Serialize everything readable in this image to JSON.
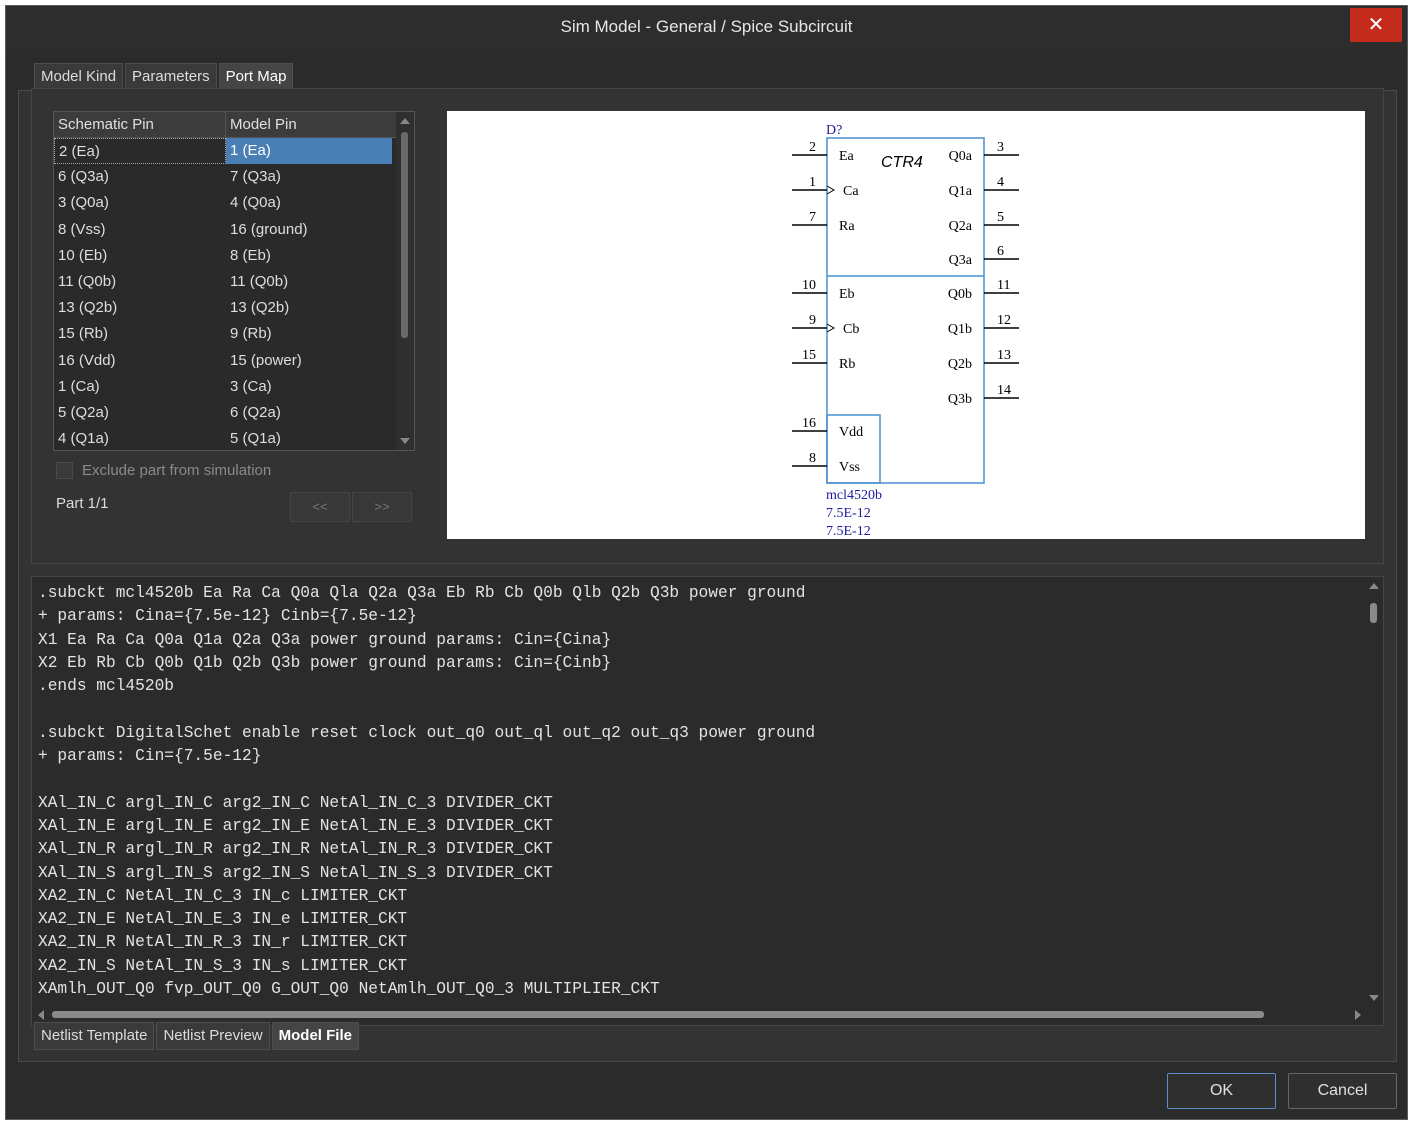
{
  "window": {
    "title": "Sim Model - General / Spice Subcircuit",
    "close_label": "✕"
  },
  "top_tabs": [
    {
      "label": "Model Kind",
      "active": false
    },
    {
      "label": "Parameters",
      "active": false
    },
    {
      "label": "Port Map",
      "active": true
    }
  ],
  "port_map": {
    "headers": {
      "schematic": "Schematic Pin",
      "model": "Model Pin"
    },
    "rows": [
      {
        "schematic": "2 (Ea)",
        "model": "1 (Ea)"
      },
      {
        "schematic": "6 (Q3a)",
        "model": "7 (Q3a)"
      },
      {
        "schematic": "3 (Q0a)",
        "model": "4 (Q0a)"
      },
      {
        "schematic": "8 (Vss)",
        "model": "16 (ground)"
      },
      {
        "schematic": "10 (Eb)",
        "model": "8 (Eb)"
      },
      {
        "schematic": "11 (Q0b)",
        "model": "11 (Q0b)"
      },
      {
        "schematic": "13 (Q2b)",
        "model": "13 (Q2b)"
      },
      {
        "schematic": "15 (Rb)",
        "model": "9 (Rb)"
      },
      {
        "schematic": "16 (Vdd)",
        "model": "15 (power)"
      },
      {
        "schematic": "1 (Ca)",
        "model": "3 (Ca)"
      },
      {
        "schematic": "5 (Q2a)",
        "model": "6 (Q2a)"
      },
      {
        "schematic": "4 (Q1a)",
        "model": "5 (Q1a)"
      }
    ],
    "exclude_label": "Exclude part from simulation",
    "part_label": "Part 1/1",
    "prev_label": "<<",
    "next_label": ">>"
  },
  "symbol": {
    "designator": "D?",
    "type_label": "CTR4",
    "model_name": "mcl4520b",
    "param1": "7.5E-12",
    "param2": "7.5E-12",
    "left_pins": [
      {
        "num": "2",
        "name": "Ea"
      },
      {
        "num": "1",
        "name": "Ca"
      },
      {
        "num": "7",
        "name": "Ra"
      },
      {
        "num": "10",
        "name": "Eb"
      },
      {
        "num": "9",
        "name": "Cb"
      },
      {
        "num": "15",
        "name": "Rb"
      },
      {
        "num": "16",
        "name": "Vdd"
      },
      {
        "num": "8",
        "name": "Vss"
      }
    ],
    "right_pins": [
      {
        "num": "3",
        "name": "Q0a"
      },
      {
        "num": "4",
        "name": "Q1a"
      },
      {
        "num": "5",
        "name": "Q2a"
      },
      {
        "num": "6",
        "name": "Q3a"
      },
      {
        "num": "11",
        "name": "Q0b"
      },
      {
        "num": "12",
        "name": "Q1b"
      },
      {
        "num": "13",
        "name": "Q2b"
      },
      {
        "num": "14",
        "name": "Q3b"
      }
    ]
  },
  "code_lines": [
    ".subckt mcl4520b Ea Ra Ca Q0a Qla Q2a Q3a Eb Rb Cb Q0b Qlb Q2b Q3b power ground",
    "+ params: Cina={7.5e-12} Cinb={7.5e-12}",
    "X1 Ea Ra Ca Q0a Q1a Q2a Q3a power ground params: Cin={Cina}",
    "X2 Eb Rb Cb Q0b Q1b Q2b Q3b power ground params: Cin={Cinb}",
    ".ends mcl4520b",
    "",
    ".subckt DigitalSchet enable reset clock out_q0 out_ql out_q2 out_q3 power ground",
    "+ params: Cin={7.5e-12}",
    "",
    "XAl_IN_C argl_IN_C arg2_IN_C NetAl_IN_C_3 DIVIDER_CKT",
    "XAl_IN_E argl_IN_E arg2_IN_E NetAl_IN_E_3 DIVIDER_CKT",
    "XAl_IN_R argl_IN_R arg2_IN_R NetAl_IN_R_3 DIVIDER_CKT",
    "XAl_IN_S argl_IN_S arg2_IN_S NetAl_IN_S_3 DIVIDER_CKT",
    "XA2_IN_C NetAl_IN_C_3 IN_c LIMITER_CKT",
    "XA2_IN_E NetAl_IN_E_3 IN_e LIMITER_CKT",
    "XA2_IN_R NetAl_IN_R_3 IN_r LIMITER_CKT",
    "XA2_IN_S NetAl_IN_S_3 IN_s LIMITER_CKT",
    "XAmlh_OUT_Q0 fvp_OUT_Q0 G_OUT_Q0 NetAmlh_OUT_Q0_3 MULTIPLIER_CKT"
  ],
  "bottom_tabs": [
    {
      "label": "Netlist Template",
      "active": false
    },
    {
      "label": "Netlist Preview",
      "active": false
    },
    {
      "label": "Model File",
      "active": true
    }
  ],
  "buttons": {
    "ok": "OK",
    "cancel": "Cancel"
  }
}
